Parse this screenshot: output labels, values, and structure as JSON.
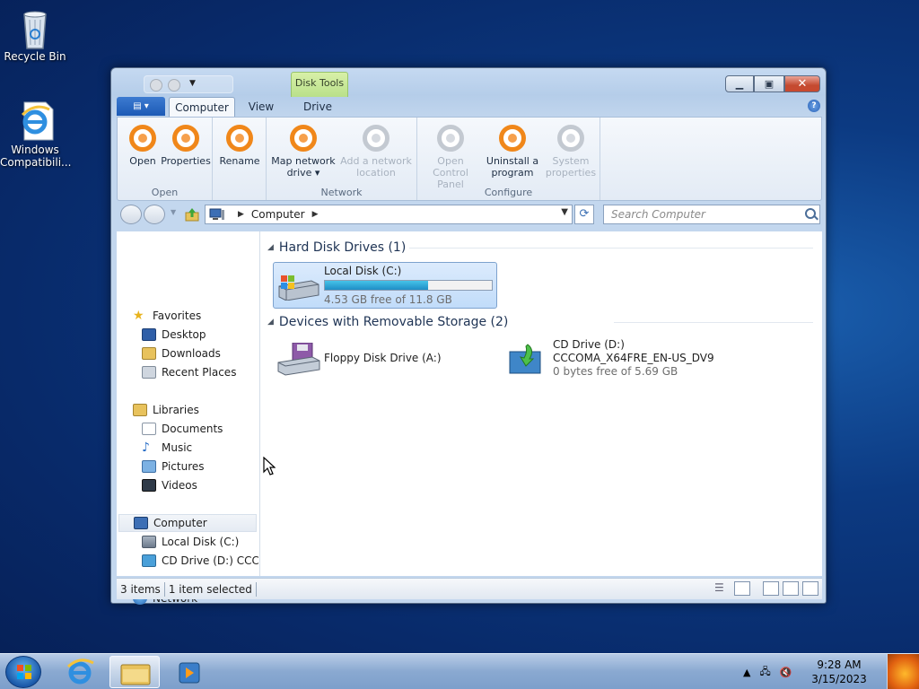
{
  "desktop": {
    "icons": [
      {
        "label": "Recycle Bin",
        "icon": "recycle-bin-icon"
      },
      {
        "label": "Windows Compatibili...",
        "icon": "internet-explorer-icon"
      }
    ]
  },
  "window": {
    "contextual_tab": "Disk Tools",
    "tabs": [
      "Computer",
      "View",
      "Drive"
    ],
    "active_tab": "Computer",
    "ribbon": {
      "groups": [
        {
          "label": "Open",
          "buttons": [
            {
              "label": "Open",
              "enabled": true
            },
            {
              "label": "Properties",
              "enabled": true
            }
          ]
        },
        {
          "label": "",
          "buttons": [
            {
              "label": "Rename",
              "enabled": true
            }
          ]
        },
        {
          "label": "Network",
          "buttons": [
            {
              "label": "Map network drive",
              "line1": "Map network",
              "line2": "drive ▾",
              "enabled": true
            },
            {
              "label": "Add a network location",
              "line1": "Add a network",
              "line2": "location",
              "enabled": false
            }
          ]
        },
        {
          "label": "Configure",
          "buttons": [
            {
              "label": "Open Control Panel",
              "line1": "Open Control",
              "line2": "Panel",
              "enabled": false
            },
            {
              "label": "Uninstall a program",
              "line1": "Uninstall a",
              "line2": "program",
              "enabled": true
            },
            {
              "label": "System properties",
              "line1": "System",
              "line2": "properties",
              "enabled": false
            }
          ]
        }
      ]
    },
    "address": {
      "crumb": "Computer",
      "search_placeholder": "Search Computer"
    },
    "nav": {
      "favorites": {
        "label": "Favorites",
        "items": [
          "Desktop",
          "Downloads",
          "Recent Places"
        ]
      },
      "libraries": {
        "label": "Libraries",
        "items": [
          "Documents",
          "Music",
          "Pictures",
          "Videos"
        ]
      },
      "computer": {
        "label": "Computer",
        "items": [
          "Local Disk (C:)",
          "CD Drive (D:) CCCOI"
        ]
      },
      "network": {
        "label": "Network"
      }
    },
    "content": {
      "hdd_group": "Hard Disk Drives (1)",
      "removable_group": "Devices with Removable Storage (2)",
      "local_disk": {
        "name": "Local Disk (C:)",
        "free_text": "4.53 GB free of 11.8 GB",
        "used_fraction": 0.616
      },
      "floppy": {
        "name": "Floppy Disk Drive (A:)"
      },
      "cd": {
        "name": "CD Drive (D:)",
        "label": "CCCOMA_X64FRE_EN-US_DV9",
        "free_text": "0 bytes free of 5.69 GB"
      }
    },
    "status": {
      "items_count": "3 items",
      "selected": "1 item selected"
    }
  },
  "taskbar": {
    "time": "9:28 AM",
    "date": "3/15/2023"
  },
  "colors": {
    "accent_orange": "#f0871a",
    "selection_blue": "#c1dcfa",
    "close_red": "#c44a30"
  }
}
